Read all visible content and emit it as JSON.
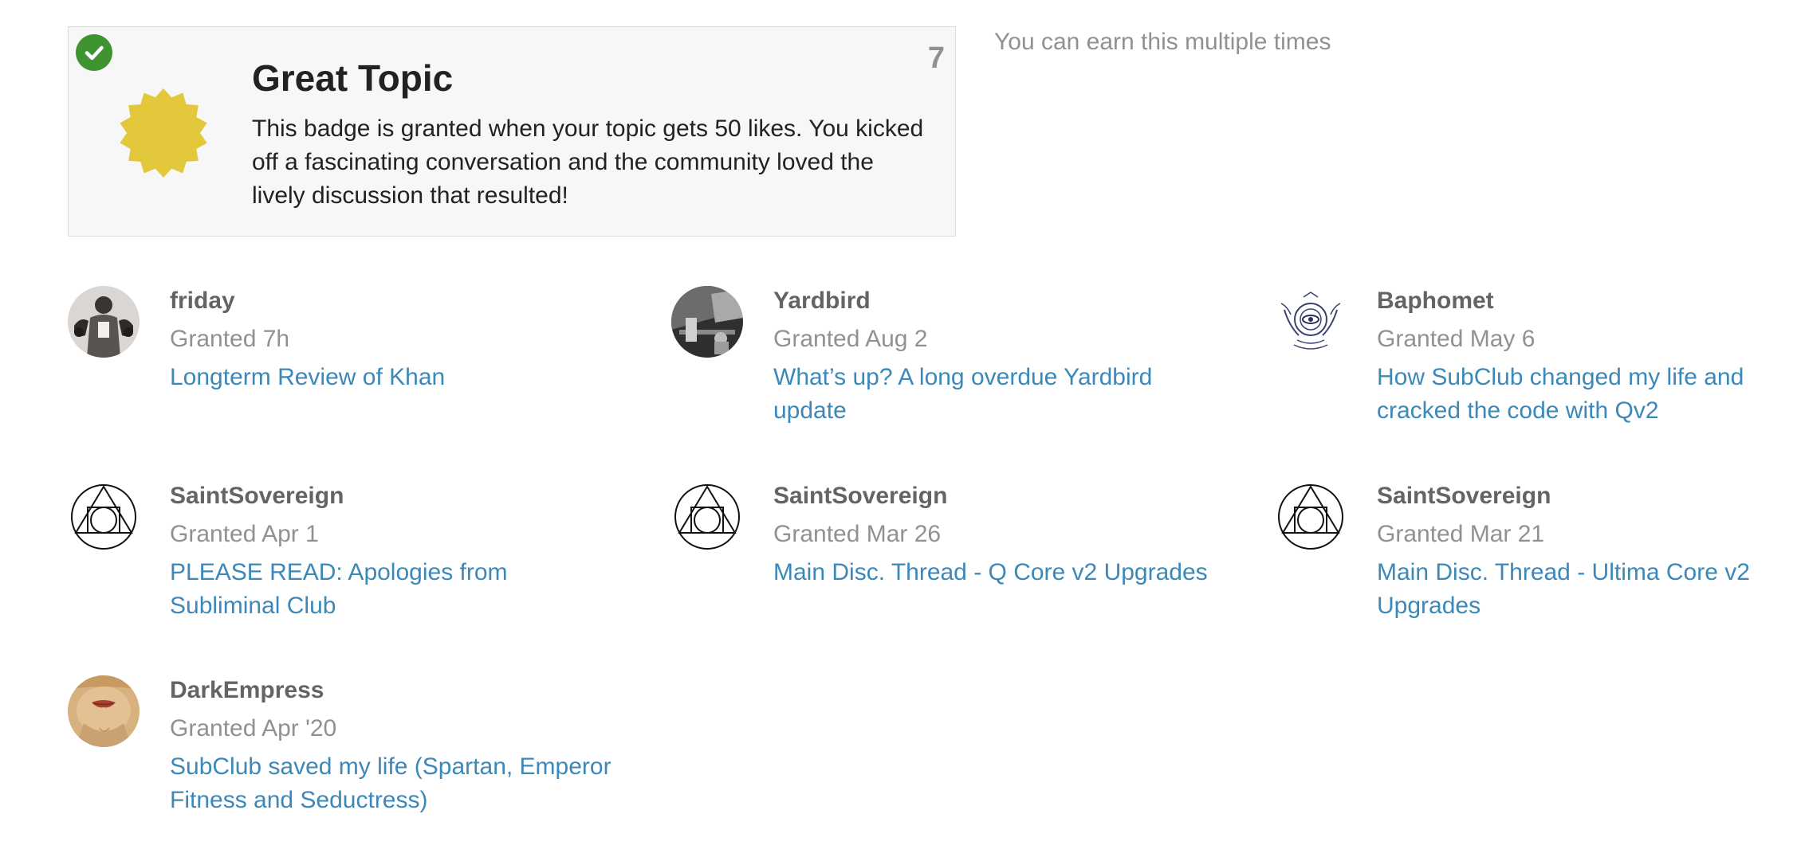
{
  "badge": {
    "title": "Great Topic",
    "description": "This badge is granted when your topic gets 50 likes. You kicked off a fascinating conversation and the community loved the lively discussion that resulted!",
    "grant_count": "7",
    "multiple_note": "You can earn this multiple times",
    "badge_color": "#e4c83c",
    "check_color": "#3f9431",
    "icon": "sunburst-badge-icon"
  },
  "grants": [
    {
      "user": "friday",
      "date": "Granted 7h",
      "topic": "Longterm Review of Khan",
      "avatar": "photo-avatar"
    },
    {
      "user": "Yardbird",
      "date": "Granted Aug 2",
      "topic": "What’s up? A long overdue Yardbird update",
      "avatar": "photo-avatar"
    },
    {
      "user": "Baphomet",
      "date": "Granted May 6",
      "topic": "How SubClub changed my life and cracked the code with Qv2",
      "avatar": "emblem-avatar"
    },
    {
      "user": "SaintSovereign",
      "date": "Granted Apr 1",
      "topic": "PLEASE READ: Apologies from Subliminal Club",
      "avatar": "alchemy-symbol-avatar"
    },
    {
      "user": "SaintSovereign",
      "date": "Granted Mar 26",
      "topic": "Main Disc. Thread - Q Core v2 Upgrades",
      "avatar": "alchemy-symbol-avatar"
    },
    {
      "user": "SaintSovereign",
      "date": "Granted Mar 21",
      "topic": "Main Disc. Thread - Ultima Core v2 Upgrades",
      "avatar": "alchemy-symbol-avatar"
    },
    {
      "user": "DarkEmpress",
      "date": "Granted Apr '20",
      "topic": "SubClub saved my life (Spartan, Emperor Fitness and Seductress)",
      "avatar": "photo-avatar"
    }
  ],
  "colors": {
    "link": "#3b88b9",
    "username": "#646464",
    "muted": "#919191"
  }
}
